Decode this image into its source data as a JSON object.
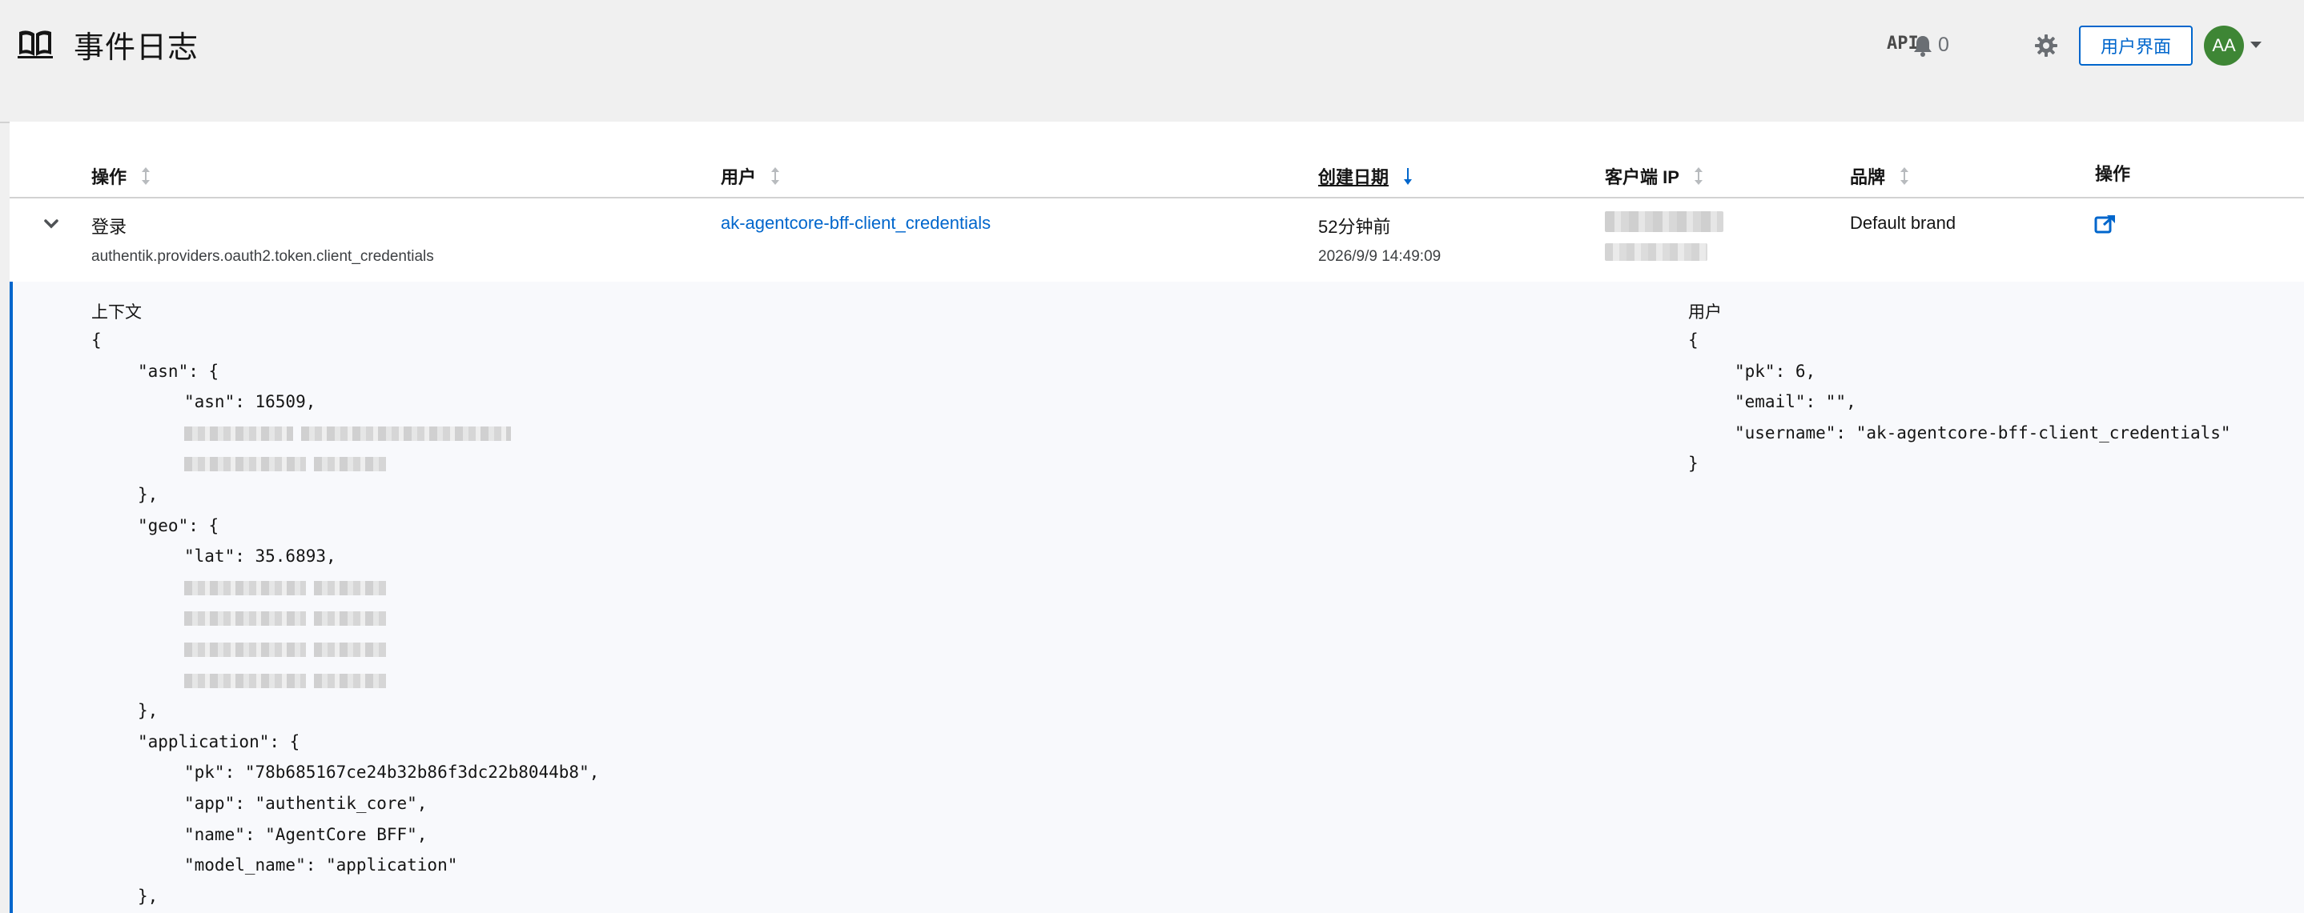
{
  "header": {
    "title": "事件日志",
    "api_label": "API",
    "notification_count": "0",
    "user_interface_label": "用户界面",
    "avatar_initials": "AA"
  },
  "table": {
    "columns": [
      {
        "label": "操作",
        "sortable": true,
        "sorted": false
      },
      {
        "label": "用户",
        "sortable": true,
        "sorted": false
      },
      {
        "label": "创建日期",
        "sortable": true,
        "sorted": true,
        "direction": "desc"
      },
      {
        "label": "客户端 IP",
        "sortable": true,
        "sorted": false
      },
      {
        "label": "品牌",
        "sortable": true,
        "sorted": false
      },
      {
        "label": "操作",
        "sortable": false,
        "sorted": false
      }
    ],
    "rows": [
      {
        "action": "登录",
        "action_detail": "authentik.providers.oauth2.token.client_credentials",
        "user": "ak-agentcore-bff-client_credentials",
        "created_relative": "52分钟前",
        "created_absolute": "2026/9/9 14:49:09",
        "brand": "Default brand",
        "expanded": true
      }
    ]
  },
  "detail": {
    "context_label": "上下文",
    "context_lines": [
      {
        "t": "{",
        "indent": 0
      },
      {
        "t": "\"asn\": {",
        "indent": 1
      },
      {
        "t": "\"asn\": 16509,",
        "indent": 2
      },
      {
        "t": "",
        "indent": 2,
        "redacted": 2
      },
      {
        "t": "",
        "indent": 2,
        "redacted": 1
      },
      {
        "t": "},",
        "indent": 1
      },
      {
        "t": "\"geo\": {",
        "indent": 1
      },
      {
        "t": "\"lat\": 35.6893,",
        "indent": 2
      },
      {
        "t": "",
        "indent": 2,
        "redacted": 1
      },
      {
        "t": "",
        "indent": 2,
        "redacted": 1
      },
      {
        "t": "",
        "indent": 2,
        "redacted": 1
      },
      {
        "t": "",
        "indent": 2,
        "redacted": 1
      },
      {
        "t": "},",
        "indent": 1
      },
      {
        "t": "\"application\": {",
        "indent": 1
      },
      {
        "t": "\"pk\": \"78b685167ce24b32b86f3dc22b8044b8\",",
        "indent": 2
      },
      {
        "t": "\"app\": \"authentik_core\",",
        "indent": 2
      },
      {
        "t": "\"name\": \"AgentCore BFF\",",
        "indent": 2
      },
      {
        "t": "\"model_name\": \"application\"",
        "indent": 2
      },
      {
        "t": "},",
        "indent": 1
      }
    ],
    "user_label": "用户",
    "user_lines": [
      {
        "t": "{",
        "indent": 0
      },
      {
        "t": "\"pk\": 6,",
        "indent": 1
      },
      {
        "t": "\"email\": \"\",",
        "indent": 1
      },
      {
        "t": "\"username\": \"ak-agentcore-bff-client_credentials\"",
        "indent": 1
      },
      {
        "t": "}",
        "indent": 0
      }
    ]
  },
  "colors": {
    "accent": "#0066cc",
    "avatar": "#3e8635",
    "header_bg": "#f0f0f0",
    "expanded_bg": "#f8f9fc"
  },
  "icons": {
    "page": "book-open-icon",
    "bell": "bell-icon",
    "settings": "gear-icon",
    "expand": "chevron-down-icon",
    "open_external": "external-link-icon"
  }
}
